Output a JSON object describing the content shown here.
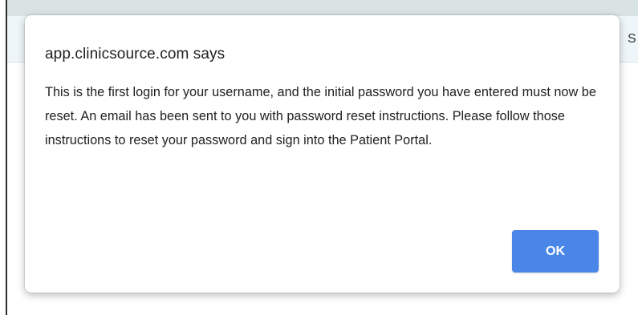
{
  "background_page": {
    "partial_text": "S by"
  },
  "dialog": {
    "title": "app.clinicsource.com says",
    "message": "This is the first login for your username, and the initial password you have entered must now be reset. An email has been sent to you with password reset instructions. Please follow those instructions to reset your password and sign into the Patient Portal.",
    "ok_label": "OK"
  },
  "colors": {
    "button_blue": "#4a86e8",
    "top_band": "#d9e3e3",
    "page_strip": "#eef6fa"
  }
}
